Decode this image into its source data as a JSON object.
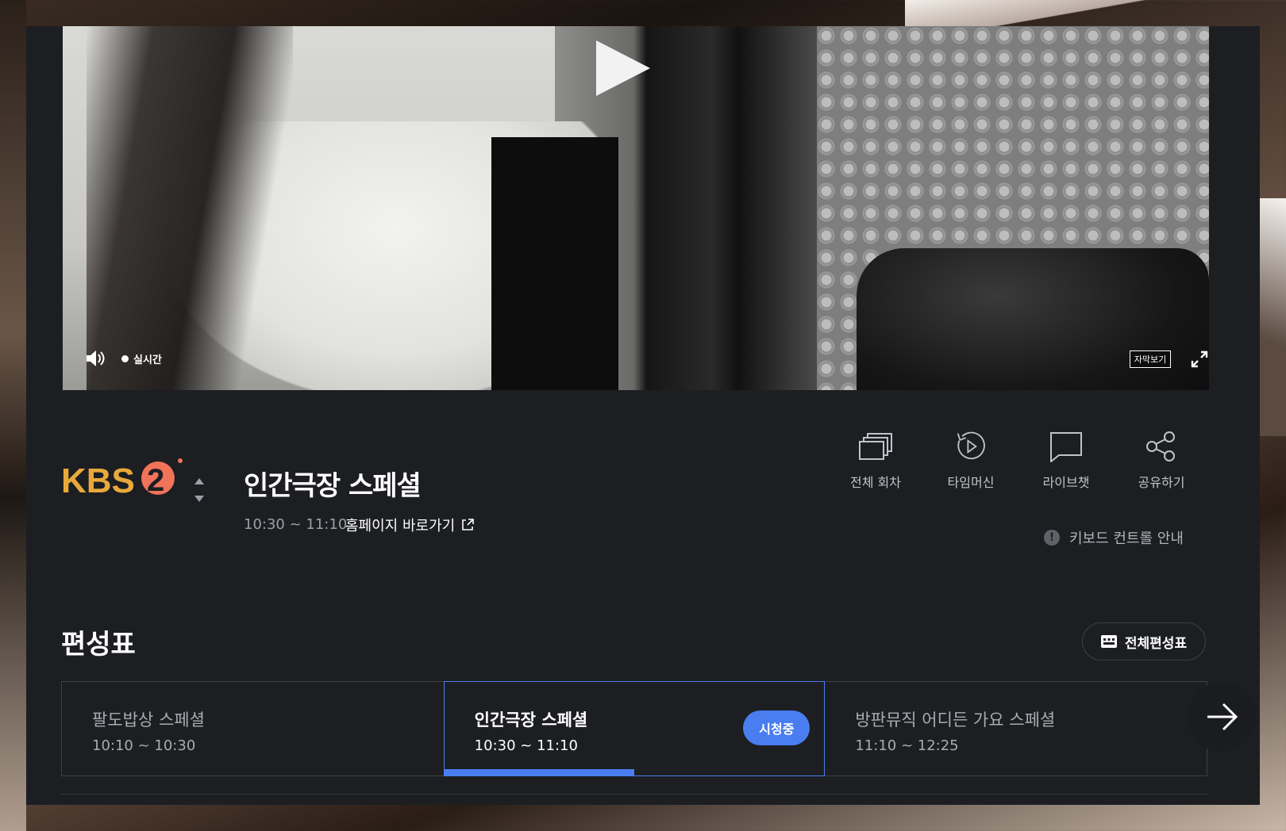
{
  "player": {
    "live_label": "실시간",
    "subtitles_label": "자막보기",
    "icons": {
      "play": "play-icon",
      "volume": "volume-icon",
      "fullscreen": "fullscreen-icon"
    }
  },
  "channel": {
    "logo_text": "KBS",
    "logo_number": "2",
    "colors": {
      "kbs_gold": "#e8a93a",
      "logo_orange": "#f0735a"
    }
  },
  "program": {
    "title": "인간극장 스페셜",
    "time": "10:30 ~ 11:10",
    "homepage_link": "홈페이지 바로가기"
  },
  "actions": [
    {
      "label": "전체 회차",
      "icon": "episodes-icon"
    },
    {
      "label": "타임머신",
      "icon": "timemachine-icon"
    },
    {
      "label": "라이브챗",
      "icon": "chat-icon"
    },
    {
      "label": "공유하기",
      "icon": "share-icon"
    }
  ],
  "keyboard_guide": "키보드 컨트롤 안내",
  "schedule": {
    "heading": "편성표",
    "full_button": "전체편성표",
    "items": [
      {
        "name": "팔도밥상 스페셜",
        "time": "10:10 ~ 10:30"
      },
      {
        "name": "인간극장 스페셜",
        "time": "10:30 ~ 11:10",
        "badge": "시청중",
        "progress": 0.5
      },
      {
        "name": "방판뮤직 어디든 가요 스페셜",
        "time": "11:10 ~ 12:25"
      }
    ],
    "accent_color": "#4a7df0"
  }
}
